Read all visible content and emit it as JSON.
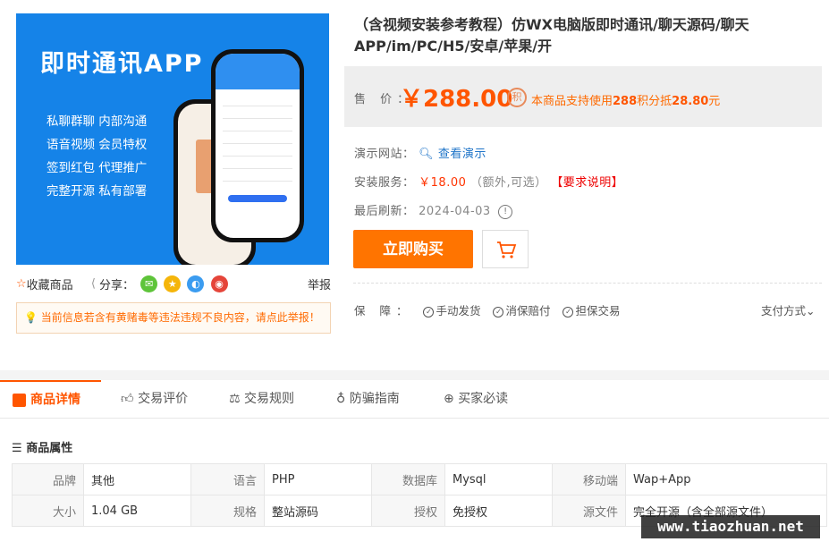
{
  "product_image": {
    "headline": "即时通讯APP",
    "features": [
      "私聊群聊  内部沟通",
      "语音视频  会员特权",
      "签到红包  代理推广",
      "完整开源  私有部署"
    ]
  },
  "under_image": {
    "favorite_label": "收藏商品",
    "share_label": "分享：",
    "report_label": "举报",
    "warning_text": "当前信息若含有黄赌毒等违法违规不良内容，请点此举报！"
  },
  "product": {
    "title": "（含视频安装参考教程）仿WX电脑版即时通讯/聊天源码/聊天APP/im/PC/H5/安卓/苹果/开",
    "price_label": "售 价：",
    "price": "￥288.00",
    "points_prefix": "本商品支持使用",
    "points_value": "288",
    "points_mid": "积分抵",
    "points_amount": "28.80",
    "points_suffix": "元",
    "demo_label": "演示网站：",
    "demo_link": "查看演示",
    "install_label": "安装服务：",
    "install_price": "￥18.00",
    "install_note": "（额外,可选）",
    "install_req": "【要求说明】",
    "refresh_label": "最后刷新：",
    "refresh_date": "2024-04-03",
    "buy_label": "立即购买",
    "guarantee_label": "保 障：",
    "guarantees": [
      "手动发货",
      "消保赔付",
      "担保交易"
    ],
    "pay_mode": "支付方式"
  },
  "tabs": [
    "商品详情",
    "交易评价",
    "交易规则",
    "防骗指南",
    "买家必读"
  ],
  "attributes_title": "商品属性",
  "attributes": [
    [
      [
        "品牌",
        "其他"
      ],
      [
        "语言",
        "PHP"
      ],
      [
        "数据库",
        "Mysql"
      ],
      [
        "移动端",
        "Wap+App"
      ]
    ],
    [
      [
        "大小",
        "1.04 GB"
      ],
      [
        "规格",
        "整站源码"
      ],
      [
        "授权",
        "免授权"
      ],
      [
        "源文件",
        "完全开源（含全部源文件）"
      ]
    ]
  ],
  "watermark": "www.tiaozhuan.net",
  "colors": {
    "accent": "#ff5500",
    "buy_button": "#ff7400",
    "image_bg": "#1583e8",
    "link": "#1e74c8"
  }
}
